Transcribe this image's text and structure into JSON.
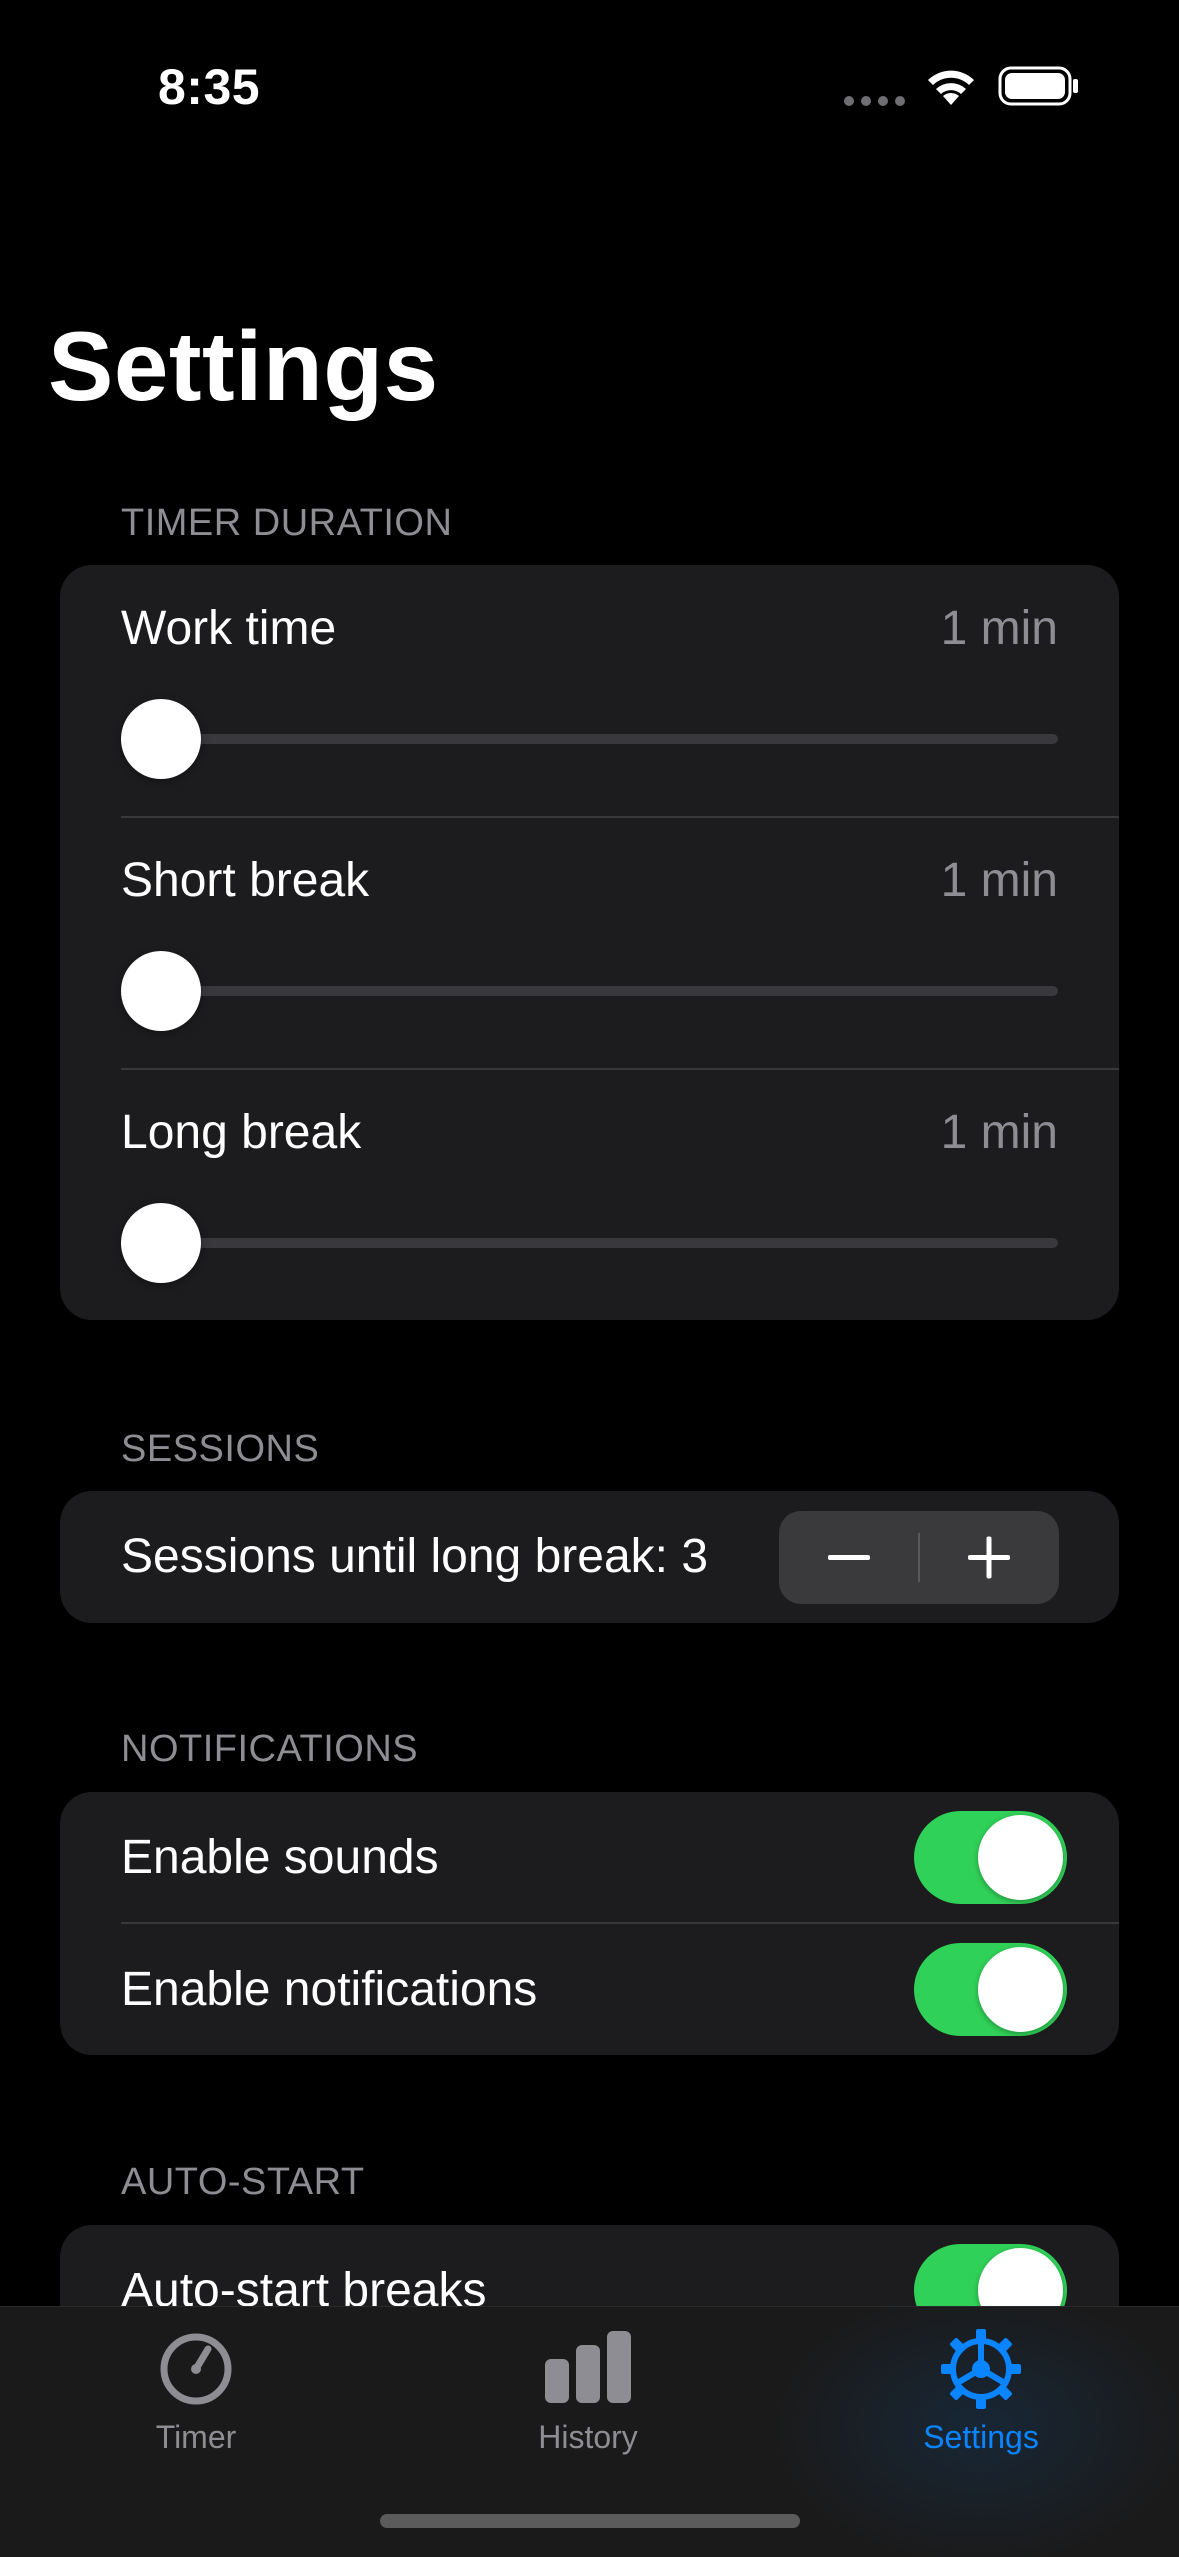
{
  "status_bar": {
    "time": "8:35"
  },
  "page": {
    "title": "Settings"
  },
  "sections": {
    "timer_duration": {
      "header": "TIMER DURATION",
      "rows": [
        {
          "label": "Work time",
          "value": "1 min",
          "level": 0.0
        },
        {
          "label": "Short break",
          "value": "1 min",
          "level": 0.0
        },
        {
          "label": "Long break",
          "value": "1 min",
          "level": 0.0
        }
      ]
    },
    "sessions": {
      "header": "SESSIONS",
      "label": "Sessions until long break: 3",
      "decrement_icon": "minus-icon",
      "increment_icon": "plus-icon"
    },
    "notifications": {
      "header": "NOTIFICATIONS",
      "rows": [
        {
          "label": "Enable sounds",
          "on": true
        },
        {
          "label": "Enable notifications",
          "on": true
        }
      ]
    },
    "auto_start": {
      "header": "AUTO-START",
      "rows": [
        {
          "label": "Auto-start breaks",
          "on": true
        }
      ]
    }
  },
  "tab_bar": {
    "tabs": [
      {
        "label": "Timer",
        "icon": "timer-icon",
        "active": false
      },
      {
        "label": "History",
        "icon": "bar-chart-icon",
        "active": false
      },
      {
        "label": "Settings",
        "icon": "gear-icon",
        "active": true
      }
    ]
  },
  "colors": {
    "accent": "#0a84ff",
    "toggle_on": "#30d158",
    "card_background": "#1c1c1e",
    "secondary_text": "#8d8d93"
  }
}
